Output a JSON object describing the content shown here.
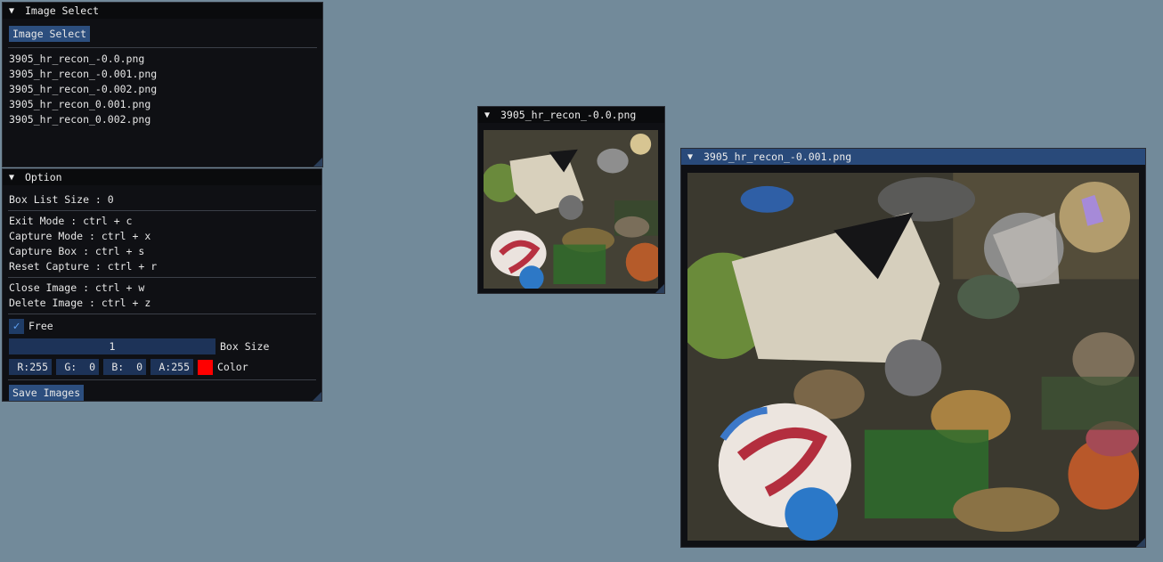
{
  "image_select_window": {
    "title": "Image Select",
    "button_label": "Image Select",
    "files": [
      "3905_hr_recon_-0.0.png",
      "3905_hr_recon_-0.001.png",
      "3905_hr_recon_-0.002.png",
      "3905_hr_recon_0.001.png",
      "3905_hr_recon_0.002.png"
    ]
  },
  "option_window": {
    "title": "Option",
    "box_list_size": "Box List Size : 0",
    "shortcuts_mode": [
      "Exit Mode : ctrl + c",
      "Capture Mode : ctrl + x",
      "Capture Box : ctrl + s",
      "Reset Capture : ctrl + r"
    ],
    "shortcuts_image": [
      "Close Image : ctrl + w",
      "Delete Image : ctrl + z"
    ],
    "free_label": "Free",
    "free_checked": true,
    "box_size_value": "1",
    "box_size_label": "Box Size",
    "color": {
      "r": "R:255",
      "g": "G:  0",
      "b": "B:  0",
      "a": "A:255",
      "label": "Color",
      "swatch": "#ff0000"
    },
    "save_label": "Save Images"
  },
  "image_windows": [
    {
      "title": "3905_hr_recon_-0.0.png",
      "active": false
    },
    {
      "title": "3905_hr_recon_-0.001.png",
      "active": true
    }
  ],
  "colors": {
    "background": "#728a9a",
    "accent": "#2c4e7e",
    "active_title": "#294a7a"
  }
}
